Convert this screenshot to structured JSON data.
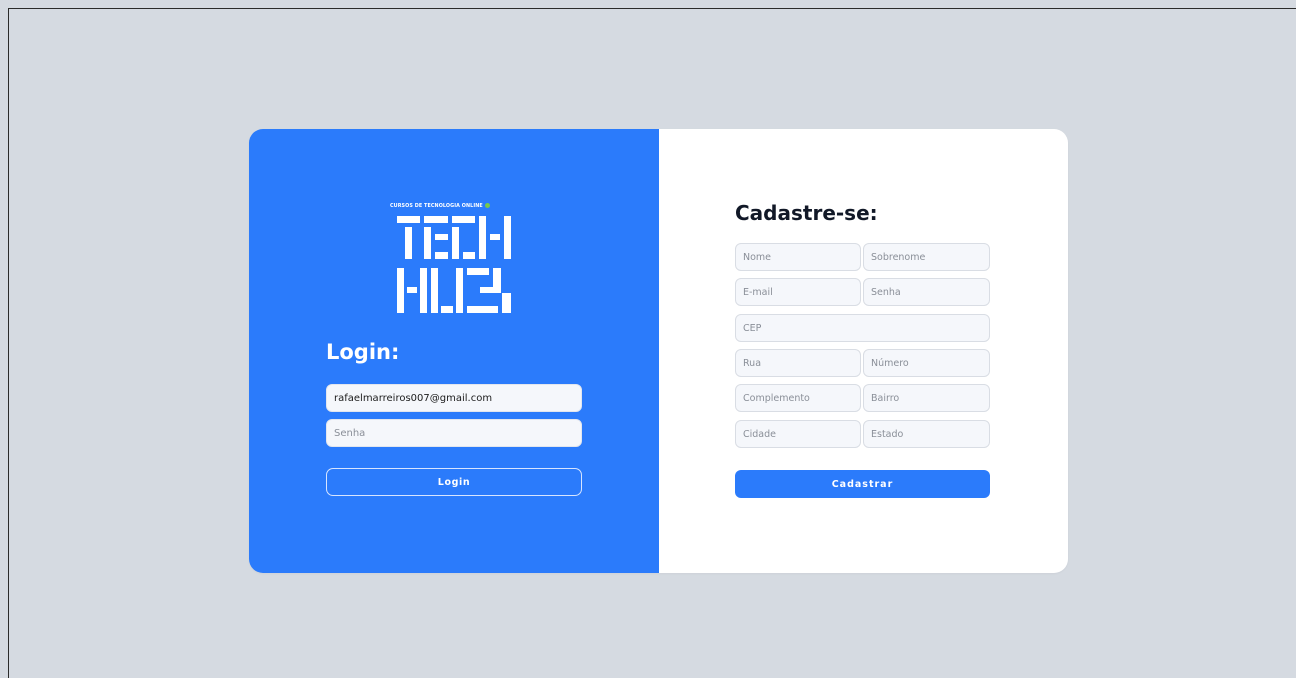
{
  "brand": {
    "tagline": "CURSOS DE TECNOLOGIA ONLINE",
    "logo_line1": "TECH",
    "logo_line2": "HUB",
    "accent_color": "#2b7bfb",
    "tagline_dot_color": "#78c84a"
  },
  "login": {
    "title": "Login:",
    "email_value": "rafaelmarreiros007@gmail.com",
    "password_placeholder": "Senha",
    "button_label": "Login"
  },
  "register": {
    "title": "Cadastre-se:",
    "fields": {
      "nome": "Nome",
      "sobrenome": "Sobrenome",
      "email": "E-mail",
      "senha": "Senha",
      "cep": "CEP",
      "rua": "Rua",
      "numero": "Número",
      "complemento": "Complemento",
      "bairro": "Bairro",
      "cidade": "Cidade",
      "estado": "Estado"
    },
    "button_label": "Cadastrar"
  },
  "colors": {
    "page_background": "#d5dae1",
    "left_panel": "#2b7bfb",
    "right_panel": "#ffffff",
    "title_dark": "#111827"
  }
}
